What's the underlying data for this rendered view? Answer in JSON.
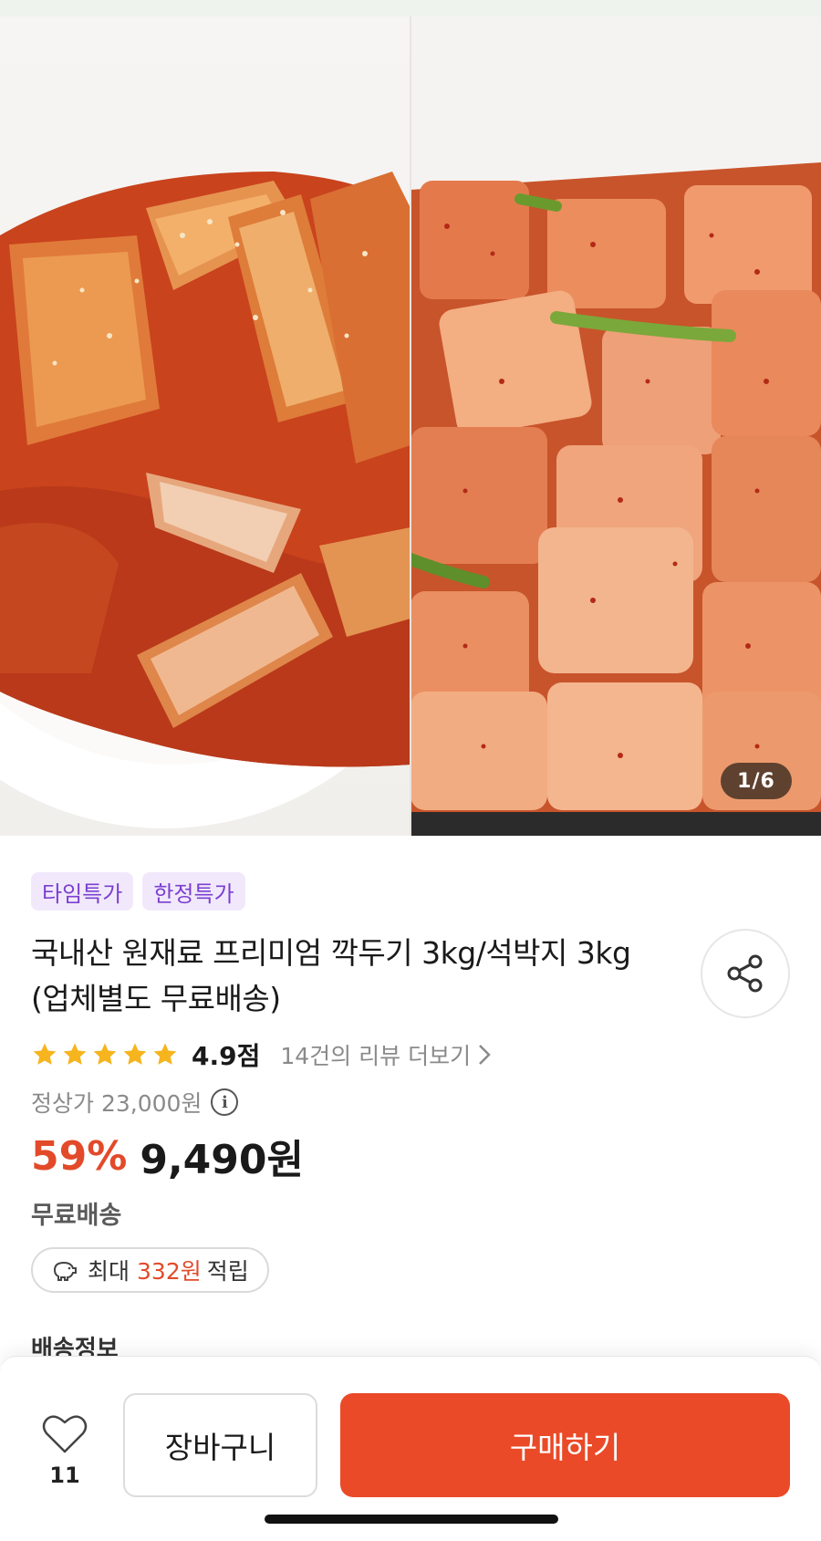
{
  "gallery": {
    "counter": "1/6",
    "left_image": "seokbakji-photo",
    "right_image": "kkakdugi-photo"
  },
  "badges": [
    "타임특가",
    "한정특가"
  ],
  "product": {
    "title": "국내산 원재료 프리미엄 깍두기 3kg/석박지 3kg (업체별도 무료배송)",
    "rating": 4.9,
    "rating_label": "4.9점",
    "review_link": "14건의 리뷰 더보기",
    "regular_price_label": "정상가 23,000원",
    "discount_label": "59%",
    "price_label": "9,490원",
    "shipping_label": "무료배송"
  },
  "points": {
    "prefix": "최대",
    "amount": "332원",
    "suffix": "적립"
  },
  "section_peek": "배송정보",
  "action_bar": {
    "like_count": "11",
    "cart_label": "장바구니",
    "buy_label": "구매하기"
  },
  "icons": {
    "share": "share-icon",
    "star": "star-icon",
    "chevron": "chevron-right-icon",
    "info": "info-icon",
    "points": "piggy-bank-icon",
    "heart": "heart-icon"
  },
  "colors": {
    "accent": "#ea4a28",
    "discount": "#e24a2a",
    "badge_bg": "#f1e9fb",
    "badge_text": "#7b3fd0",
    "star": "#f6b51e"
  }
}
